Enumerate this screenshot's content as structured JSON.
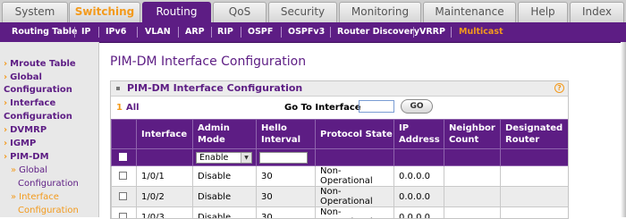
{
  "top_tabs": [
    "System",
    "Switching",
    "Routing",
    "QoS",
    "Security",
    "Monitoring",
    "Maintenance",
    "Help",
    "Index"
  ],
  "sub_nav": [
    "Routing Table",
    "IP",
    "IPv6",
    "VLAN",
    "ARP",
    "RIP",
    "OSPF",
    "OSPFv3",
    "Router Discovery",
    "VRRP",
    "Multicast"
  ],
  "sidebar": [
    {
      "label": "Mroute Table"
    },
    {
      "label": "Global"
    },
    {
      "label": "Configuration"
    },
    {
      "label": "Interface"
    },
    {
      "label": "Configuration"
    },
    {
      "label": "DVMRP"
    },
    {
      "label": "IGMP"
    },
    {
      "label": "PIM-DM"
    },
    {
      "label": "Global"
    },
    {
      "label": "Configuration"
    },
    {
      "label": "Interface"
    },
    {
      "label": "Configuration"
    }
  ],
  "page_title": "PIM-DM Interface Configuration",
  "panel": {
    "title": "PIM-DM Interface Configuration",
    "help": "?",
    "count": "1",
    "count_label": "All",
    "goto_label": "Go To Interface",
    "goto_value": "",
    "go_button": "GO"
  },
  "table": {
    "headers": [
      "",
      "Interface",
      "Admin Mode",
      "Hello Interval",
      "Protocol State",
      "IP Address",
      "Neighbor Count",
      "Designated Router"
    ],
    "filter": {
      "admin_mode": "Enable",
      "hello_interval": ""
    },
    "rows": [
      {
        "interface": "1/0/1",
        "admin": "Disable",
        "hello": "30",
        "state": "Non-Operational",
        "ip": "0.0.0.0",
        "neighbors": "",
        "dr": ""
      },
      {
        "interface": "1/0/2",
        "admin": "Disable",
        "hello": "30",
        "state": "Non-Operational",
        "ip": "0.0.0.0",
        "neighbors": "",
        "dr": ""
      },
      {
        "interface": "1/0/3",
        "admin": "Disable",
        "hello": "30",
        "state": "Non-Operational",
        "ip": "0.0.0.0",
        "neighbors": "",
        "dr": ""
      }
    ]
  },
  "colors": {
    "brand": "#5d1d84",
    "accent": "#f39a1c"
  }
}
